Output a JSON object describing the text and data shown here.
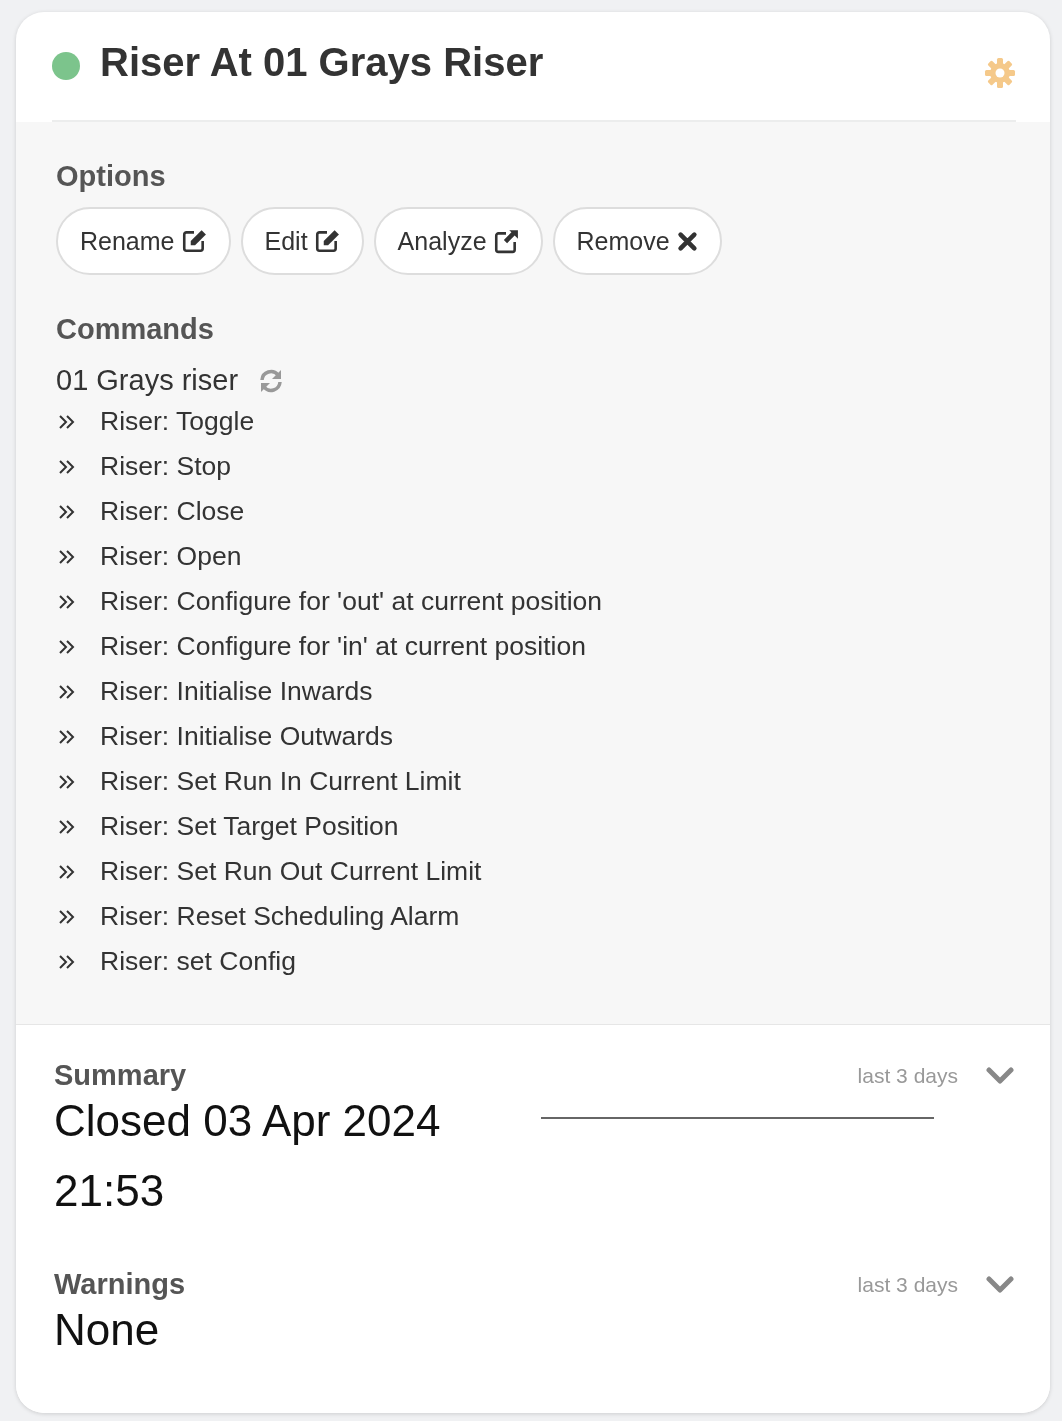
{
  "header": {
    "title": "Riser At 01 Grays Riser",
    "online": true
  },
  "options": {
    "heading": "Options",
    "buttons": [
      {
        "label": "Rename",
        "kind": "edit"
      },
      {
        "label": "Edit",
        "kind": "edit"
      },
      {
        "label": "Analyze",
        "kind": "external"
      },
      {
        "label": "Remove",
        "kind": "remove"
      }
    ]
  },
  "commands": {
    "heading": "Commands",
    "device": "01 Grays riser",
    "items": [
      "Riser: Toggle",
      "Riser: Stop",
      "Riser: Close",
      "Riser: Open",
      "Riser: Configure for 'out' at current position",
      "Riser: Configure for 'in' at current position",
      "Riser: Initialise Inwards",
      "Riser: Initialise Outwards",
      "Riser: Set Run In Current Limit",
      "Riser: Set Target Position",
      "Riser: Set Run Out Current Limit",
      "Riser: Reset Scheduling Alarm",
      "Riser: set Config"
    ]
  },
  "summary": {
    "heading": "Summary",
    "range": "last 3 days",
    "value": "Closed 03 Apr 2024 21:53"
  },
  "warnings": {
    "heading": "Warnings",
    "range": "last 3 days",
    "value": "None"
  }
}
